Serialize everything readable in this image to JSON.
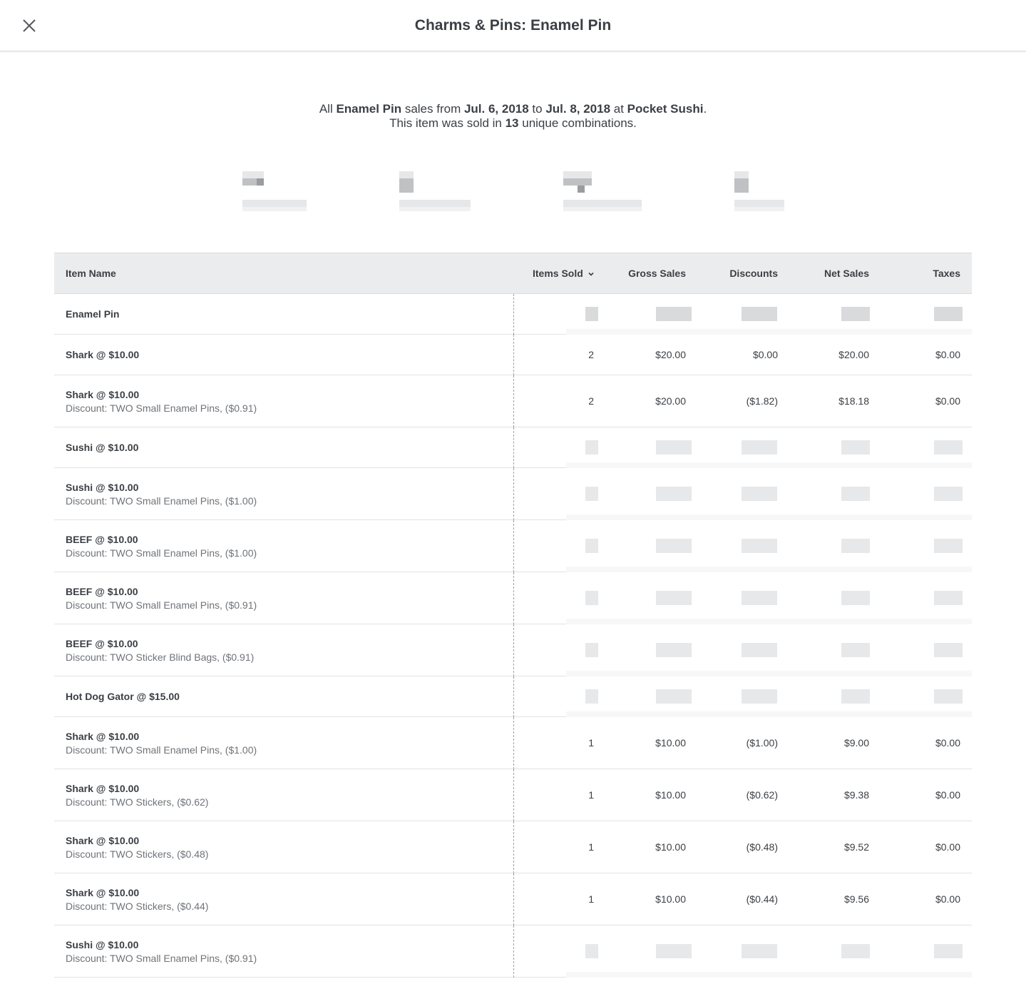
{
  "header": {
    "title": "Charms & Pins: Enamel Pin",
    "close_icon": "close-icon"
  },
  "summary": {
    "line1_prefix": "All ",
    "item": "Enamel Pin",
    "line1_mid1": " sales from ",
    "date_from": "Jul. 6, 2018",
    "line1_mid2": " to ",
    "date_to": "Jul. 8, 2018",
    "line1_mid3": " at ",
    "location": "Pocket Sushi",
    "line1_suffix": ".",
    "line2_prefix": "This item was sold in ",
    "combinations": "13",
    "line2_suffix": " unique combinations."
  },
  "table": {
    "columns": [
      "Item Name",
      "Items Sold",
      "Gross Sales",
      "Discounts",
      "Net Sales",
      "Taxes"
    ],
    "sort_icon": "chevron-down-icon",
    "rows": [
      {
        "name": "Enamel Pin",
        "sub": "",
        "sold": "",
        "gross": "",
        "discounts": "",
        "net": "",
        "taxes": "",
        "obscured": true
      },
      {
        "name": "Shark @ $10.00",
        "sub": "",
        "sold": "2",
        "gross": "$20.00",
        "discounts": "$0.00",
        "net": "$20.00",
        "taxes": "$0.00",
        "obscured": false
      },
      {
        "name": "Shark @ $10.00",
        "sub": "Discount: TWO Small Enamel Pins, ($0.91)",
        "sold": "2",
        "gross": "$20.00",
        "discounts": "($1.82)",
        "net": "$18.18",
        "taxes": "$0.00",
        "obscured": false
      },
      {
        "name": "Sushi @ $10.00",
        "sub": "",
        "sold": "",
        "gross": "",
        "discounts": "",
        "net": "",
        "taxes": "",
        "obscured": true
      },
      {
        "name": "Sushi @ $10.00",
        "sub": "Discount: TWO Small Enamel Pins, ($1.00)",
        "sold": "",
        "gross": "",
        "discounts": "",
        "net": "",
        "taxes": "",
        "obscured": true
      },
      {
        "name": "BEEF @ $10.00",
        "sub": "Discount: TWO Small Enamel Pins, ($1.00)",
        "sold": "",
        "gross": "",
        "discounts": "",
        "net": "",
        "taxes": "",
        "obscured": true
      },
      {
        "name": "BEEF @ $10.00",
        "sub": "Discount: TWO Small Enamel Pins, ($0.91)",
        "sold": "",
        "gross": "",
        "discounts": "",
        "net": "",
        "taxes": "",
        "obscured": true
      },
      {
        "name": "BEEF @ $10.00",
        "sub": "Discount: TWO Sticker Blind Bags, ($0.91)",
        "sold": "",
        "gross": "",
        "discounts": "",
        "net": "",
        "taxes": "",
        "obscured": true
      },
      {
        "name": "Hot Dog Gator @ $15.00",
        "sub": "",
        "sold": "",
        "gross": "",
        "discounts": "",
        "net": "",
        "taxes": "",
        "obscured": true
      },
      {
        "name": "Shark @ $10.00",
        "sub": "Discount: TWO Small Enamel Pins, ($1.00)",
        "sold": "1",
        "gross": "$10.00",
        "discounts": "($1.00)",
        "net": "$9.00",
        "taxes": "$0.00",
        "obscured": false
      },
      {
        "name": "Shark @ $10.00",
        "sub": "Discount: TWO Stickers, ($0.62)",
        "sold": "1",
        "gross": "$10.00",
        "discounts": "($0.62)",
        "net": "$9.38",
        "taxes": "$0.00",
        "obscured": false
      },
      {
        "name": "Shark @ $10.00",
        "sub": "Discount: TWO Stickers, ($0.48)",
        "sold": "1",
        "gross": "$10.00",
        "discounts": "($0.48)",
        "net": "$9.52",
        "taxes": "$0.00",
        "obscured": false
      },
      {
        "name": "Shark @ $10.00",
        "sub": "Discount: TWO Stickers, ($0.44)",
        "sold": "1",
        "gross": "$10.00",
        "discounts": "($0.44)",
        "net": "$9.56",
        "taxes": "$0.00",
        "obscured": false
      },
      {
        "name": "Sushi @ $10.00",
        "sub": "Discount: TWO Small Enamel Pins, ($0.91)",
        "sold": "",
        "gross": "",
        "discounts": "",
        "net": "",
        "taxes": "",
        "obscured": true
      }
    ]
  },
  "colors": {
    "text": "#3b3f44",
    "muted": "#6f7378",
    "header_bg": "#ebeced",
    "border": "#d9dadb"
  }
}
